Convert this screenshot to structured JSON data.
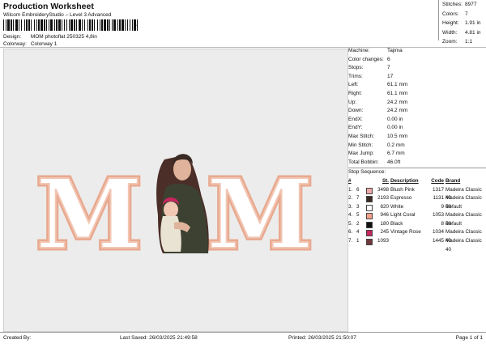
{
  "header": {
    "title": "Production Worksheet",
    "subtitle": "Wilcom EmbroideryStudio – Level 3 Advanced",
    "barcode_suffix": ","
  },
  "meta": [
    {
      "key": "Design:",
      "value": "MOM photoflat 250325 4,8in"
    },
    {
      "key": "Colorway:",
      "value": "Colorway 1"
    }
  ],
  "stats": [
    {
      "key": "Stitches:",
      "value": "8977"
    },
    {
      "key": "Colors:",
      "value": "7"
    },
    {
      "key": "Height:",
      "value": "1.91 in"
    },
    {
      "key": "Width:",
      "value": "4.81 in"
    },
    {
      "key": "Zoom:",
      "value": "1:1"
    }
  ],
  "design_preview": {
    "left_letter": "M",
    "right_letter": "M",
    "letter_fill": "#ffffff",
    "letter_outline": "#e8a98f",
    "letter_outline_inner": "#f2c6b4"
  },
  "machine_info": [
    {
      "key": "Machine:",
      "value": "Tajima"
    },
    {
      "key": "Color changes:",
      "value": "6"
    },
    {
      "key": "Stops:",
      "value": "7"
    },
    {
      "key": "Trims:",
      "value": "17"
    },
    {
      "key": "Left:",
      "value": "61.1 mm"
    },
    {
      "key": "Right:",
      "value": "61.1 mm"
    },
    {
      "key": "Up:",
      "value": "24.2 mm"
    },
    {
      "key": "Down:",
      "value": "24.2 mm"
    },
    {
      "key": "EndX:",
      "value": "0.00 in"
    },
    {
      "key": "EndY:",
      "value": "0.00 in"
    },
    {
      "key": "Max Stitch:",
      "value": "10.5 mm"
    },
    {
      "key": "Min Stitch:",
      "value": "0.2 mm"
    },
    {
      "key": "Max Jump:",
      "value": "6.7 mm"
    },
    {
      "key": "Total Bobbin:",
      "value": "46.0ft"
    }
  ],
  "stop_sequence": {
    "label": "Stop Sequence:",
    "headers": {
      "num": "#",
      "stop": "",
      "st": "St.",
      "description": "Description",
      "code": "Code",
      "brand": "Brand"
    },
    "rows": [
      {
        "num": "1.",
        "stop": "6",
        "color": "#f0a7a7",
        "st": "3498",
        "description": "Blush Pink",
        "code": "1317",
        "brand": "Madeira Classic 40"
      },
      {
        "num": "2.",
        "stop": "7",
        "color": "#3a2a24",
        "st": "2193",
        "description": "Espresso",
        "code": "1131",
        "brand": "Madeira Classic 40"
      },
      {
        "num": "3.",
        "stop": "3",
        "color": "#ffffff",
        "st": "820",
        "description": "White",
        "code": "9",
        "brand": "Default"
      },
      {
        "num": "4.",
        "stop": "5",
        "color": "#f3a08a",
        "st": "946",
        "description": "Light Coral",
        "code": "1053",
        "brand": "Madeira Classic 40"
      },
      {
        "num": "5.",
        "stop": "2",
        "color": "#111111",
        "st": "180",
        "description": "Black",
        "code": "8",
        "brand": "Default"
      },
      {
        "num": "6.",
        "stop": "4",
        "color": "#c7265f",
        "st": "245",
        "description": "Vintage Rose",
        "code": "1034",
        "brand": "Madeira Classic 40"
      },
      {
        "num": "7.",
        "stop": "1",
        "color": "#6e3a3c",
        "st": "1093",
        "description": "",
        "code": "1445",
        "brand": "Madeira Classic 40"
      }
    ]
  },
  "footer": {
    "created_by": "Created By:",
    "last_saved": "Last Saved: 26/03/2025 21:49:58",
    "printed": "Printed: 26/03/2025 21:50:07",
    "page": "Page 1 of 1"
  }
}
